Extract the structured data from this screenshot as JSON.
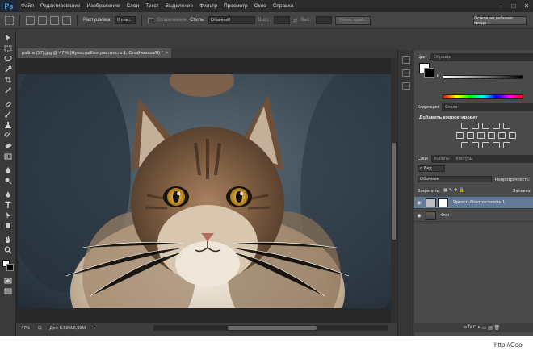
{
  "menu": {
    "logo": "Ps",
    "items": [
      "Файл",
      "Редактирование",
      "Изображение",
      "Слои",
      "Текст",
      "Выделение",
      "Фильтр",
      "Просмотр",
      "Окно",
      "Справка"
    ],
    "window_controls": [
      "–",
      "□",
      "✕"
    ]
  },
  "options_bar": {
    "feather_label": "Растушевка:",
    "feather_value": "0 пикс.",
    "antialias_label": "Сглаживание",
    "style_label": "Стиль:",
    "style_value": "Обычный",
    "width_label": "Шир.:",
    "height_label": "Выс.:",
    "refine_edge": "Уточн. край...",
    "workspace": "Основная рабочая среда"
  },
  "document": {
    "tab_title": "palitra (17).jpg @ 47% (Яркость/Контрастность 1, Слой-маска/8) *",
    "tab_close": "×",
    "zoom": "47%",
    "doc_size": "Док: 6,59M/6,59M"
  },
  "color_panel": {
    "tabs": [
      "Цвет",
      "Образцы"
    ],
    "channel": "K"
  },
  "adjustments_panel": {
    "tabs": [
      "Коррекция",
      "Стили"
    ],
    "title": "Добавить корректировку"
  },
  "layers_panel": {
    "tabs": [
      "Слои",
      "Каналы",
      "Контуры"
    ],
    "filter": "Вид",
    "blend_mode": "Обычные",
    "opacity_label": "Непрозрачность:",
    "lock_label": "Закрепить:",
    "fill_label": "Заливка:",
    "layers": [
      {
        "name": "Яркость/Контрастность 1",
        "selected": true
      },
      {
        "name": "Фон",
        "selected": false
      }
    ],
    "footer_icons": [
      "∞",
      "fx",
      "◘",
      "◐",
      "▭",
      "▤",
      "🗑"
    ]
  },
  "footer_url": "http://Coo",
  "colors": {
    "app_bg": "#3c3c3c",
    "menubar": "#2b2b2b",
    "selection": "#627a96",
    "logo_blue": "#4a9be0"
  }
}
